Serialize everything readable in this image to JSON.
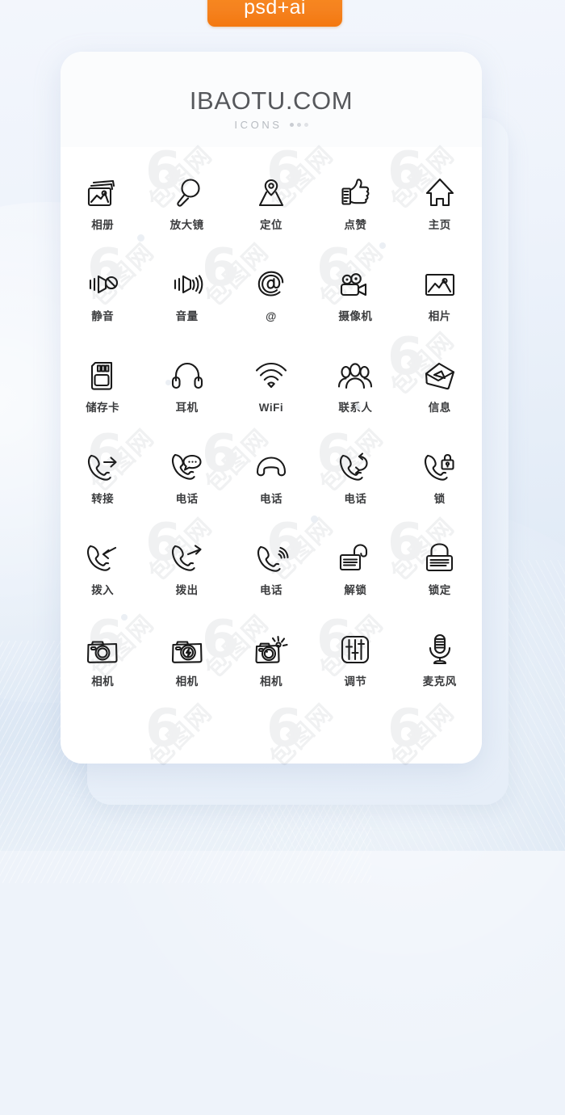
{
  "badge": {
    "label": "psd+ai",
    "color": "#f5821f"
  },
  "card": {
    "title": "IBAOTU.COM",
    "subtitle": "ICONS"
  },
  "watermark": {
    "mark": "6",
    "text": "包图网"
  },
  "colors": {
    "background_top": "#f3f6fc",
    "background_bottom": "#d7e4f2",
    "card": "#fdfdfe",
    "title_text": "#56585c",
    "label_text": "#3b3c3e",
    "icon_stroke": "#1a1a1a"
  },
  "icons": [
    {
      "label": "相册",
      "name": "album-icon"
    },
    {
      "label": "放大镜",
      "name": "magnifier-icon"
    },
    {
      "label": "定位",
      "name": "location-pin-icon"
    },
    {
      "label": "点赞",
      "name": "thumbs-up-icon"
    },
    {
      "label": "主页",
      "name": "home-icon"
    },
    {
      "label": "静音",
      "name": "mute-icon"
    },
    {
      "label": "音量",
      "name": "volume-icon"
    },
    {
      "label": "@",
      "name": "at-sign-icon"
    },
    {
      "label": "摄像机",
      "name": "camcorder-icon"
    },
    {
      "label": "相片",
      "name": "photo-icon"
    },
    {
      "label": "储存卡",
      "name": "memory-card-icon"
    },
    {
      "label": "耳机",
      "name": "headphones-icon"
    },
    {
      "label": "WiFi",
      "name": "wifi-icon"
    },
    {
      "label": "联系人",
      "name": "contacts-icon"
    },
    {
      "label": "信息",
      "name": "message-envelope-icon"
    },
    {
      "label": "转接",
      "name": "call-forward-icon"
    },
    {
      "label": "电话",
      "name": "phone-message-icon"
    },
    {
      "label": "电话",
      "name": "phone-handset-icon"
    },
    {
      "label": "电话",
      "name": "phone-refresh-icon"
    },
    {
      "label": "锁",
      "name": "phone-lock-icon"
    },
    {
      "label": "拨入",
      "name": "call-incoming-icon"
    },
    {
      "label": "拨出",
      "name": "call-outgoing-icon"
    },
    {
      "label": "电话",
      "name": "phone-ringing-icon"
    },
    {
      "label": "解锁",
      "name": "unlock-icon"
    },
    {
      "label": "锁定",
      "name": "lock-closed-icon"
    },
    {
      "label": "相机",
      "name": "camera-icon"
    },
    {
      "label": "相机",
      "name": "camera-flash-icon"
    },
    {
      "label": "相机",
      "name": "camera-shutter-icon"
    },
    {
      "label": "调节",
      "name": "sliders-adjust-icon"
    },
    {
      "label": "麦克风",
      "name": "microphone-icon"
    }
  ]
}
